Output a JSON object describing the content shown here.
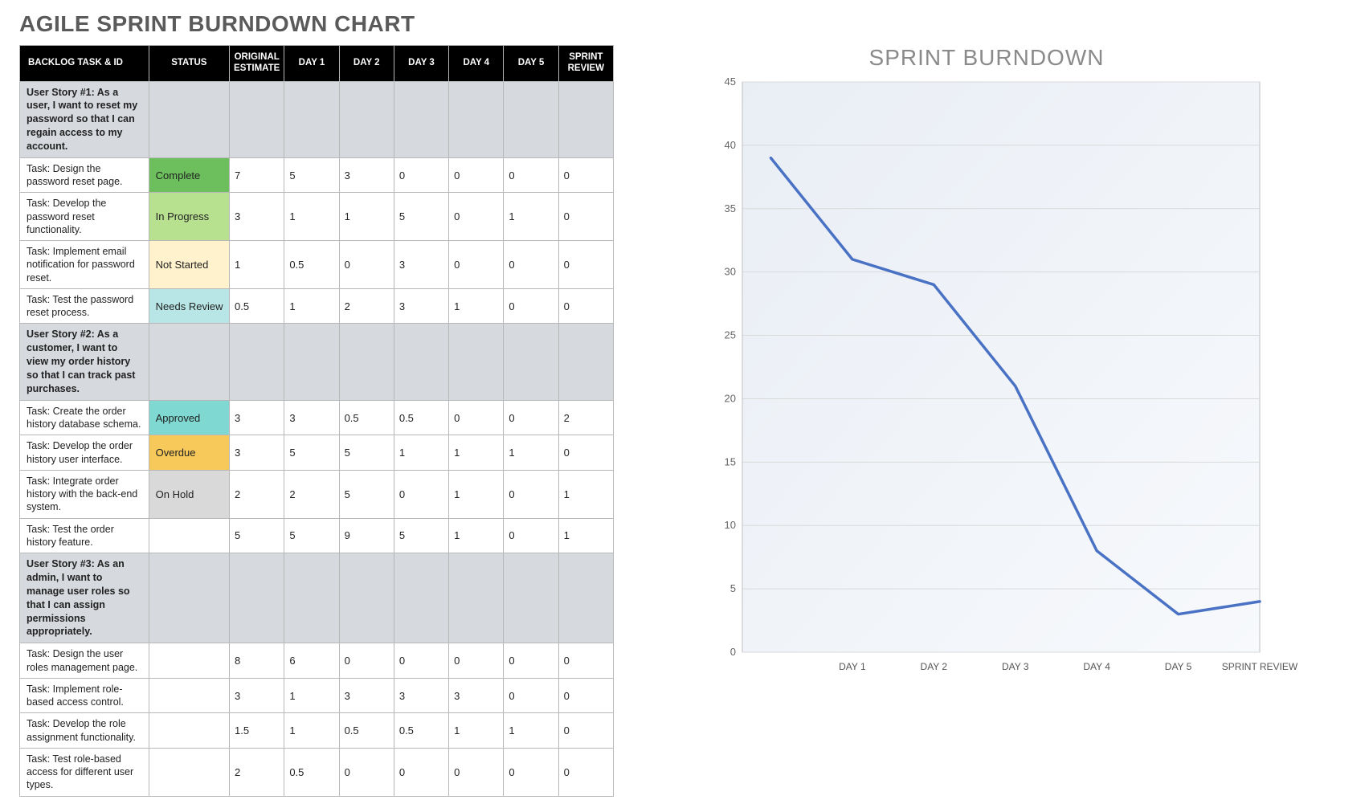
{
  "page_title": "AGILE SPRINT BURNDOWN CHART",
  "columns": [
    "BACKLOG TASK & ID",
    "STATUS",
    "ORIGINAL ESTIMATE",
    "DAY 1",
    "DAY 2",
    "DAY 3",
    "DAY 4",
    "DAY 5",
    "SPRINT REVIEW"
  ],
  "status_styles": {
    "Complete": "st-complete",
    "In Progress": "st-in-progress",
    "Not Started": "st-not-started",
    "Needs Review": "st-needs-review",
    "Approved": "st-approved",
    "Overdue": "st-overdue",
    "On Hold": "st-on-hold"
  },
  "rows": [
    {
      "type": "story",
      "task": "User Story #1: As a user, I want to reset my password so that I can regain access to my account."
    },
    {
      "type": "task",
      "task": "Task: Design the password reset page.",
      "status": "Complete",
      "vals": [
        "7",
        "5",
        "3",
        "0",
        "0",
        "0",
        "0"
      ]
    },
    {
      "type": "task",
      "task": "Task: Develop the password reset functionality.",
      "status": "In Progress",
      "vals": [
        "3",
        "1",
        "1",
        "5",
        "0",
        "1",
        "0"
      ]
    },
    {
      "type": "task",
      "task": "Task: Implement email notification for password reset.",
      "status": "Not Started",
      "vals": [
        "1",
        "0.5",
        "0",
        "3",
        "0",
        "0",
        "0"
      ]
    },
    {
      "type": "task",
      "task": "Task: Test the password reset process.",
      "status": "Needs Review",
      "vals": [
        "0.5",
        "1",
        "2",
        "3",
        "1",
        "0",
        "0"
      ]
    },
    {
      "type": "story",
      "task": "User Story #2: As a customer, I want to view my order history so that I can track past purchases."
    },
    {
      "type": "task",
      "task": "Task: Create the order history database schema.",
      "status": "Approved",
      "vals": [
        "3",
        "3",
        "0.5",
        "0.5",
        "0",
        "0",
        "2"
      ]
    },
    {
      "type": "task",
      "task": "Task: Develop the order history user interface.",
      "status": "Overdue",
      "vals": [
        "3",
        "5",
        "5",
        "1",
        "1",
        "1",
        "0"
      ]
    },
    {
      "type": "task",
      "task": "Task: Integrate order history with the back-end system.",
      "status": "On Hold",
      "vals": [
        "2",
        "2",
        "5",
        "0",
        "1",
        "0",
        "1"
      ]
    },
    {
      "type": "task",
      "task": "Task: Test the order history feature.",
      "status": "",
      "vals": [
        "5",
        "5",
        "9",
        "5",
        "1",
        "0",
        "1"
      ]
    },
    {
      "type": "story",
      "task": "User Story #3: As an admin, I want to manage user roles so that I can assign permissions appropriately."
    },
    {
      "type": "task",
      "task": "Task: Design the user roles management page.",
      "status": "",
      "vals": [
        "8",
        "6",
        "0",
        "0",
        "0",
        "0",
        "0"
      ]
    },
    {
      "type": "task",
      "task": "Task: Implement role-based access control.",
      "status": "",
      "vals": [
        "3",
        "1",
        "3",
        "3",
        "3",
        "0",
        "0"
      ]
    },
    {
      "type": "task",
      "task": "Task: Develop the role assignment functionality.",
      "status": "",
      "vals": [
        "1.5",
        "1",
        "0.5",
        "0.5",
        "1",
        "1",
        "0"
      ]
    },
    {
      "type": "task",
      "task": "Task: Test role-based access for different user types.",
      "status": "",
      "vals": [
        "2",
        "0.5",
        "0",
        "0",
        "0",
        "0",
        "0"
      ]
    }
  ],
  "chart_data": {
    "type": "line",
    "title": "SPRINT BURNDOWN",
    "xlabel": "",
    "ylabel": "",
    "categories": [
      "DAY 1",
      "DAY 2",
      "DAY 3",
      "DAY 4",
      "DAY 5",
      "SPRINT REVIEW"
    ],
    "values": [
      39,
      31,
      29,
      21,
      8,
      3,
      4
    ],
    "ylim": [
      0,
      45
    ],
    "yticks": [
      0,
      5,
      10,
      15,
      20,
      25,
      30,
      35,
      40,
      45
    ],
    "line_color": "#4a72c4",
    "plot_bg_gradient": [
      "#e9eef5",
      "#f7f9fc"
    ]
  }
}
